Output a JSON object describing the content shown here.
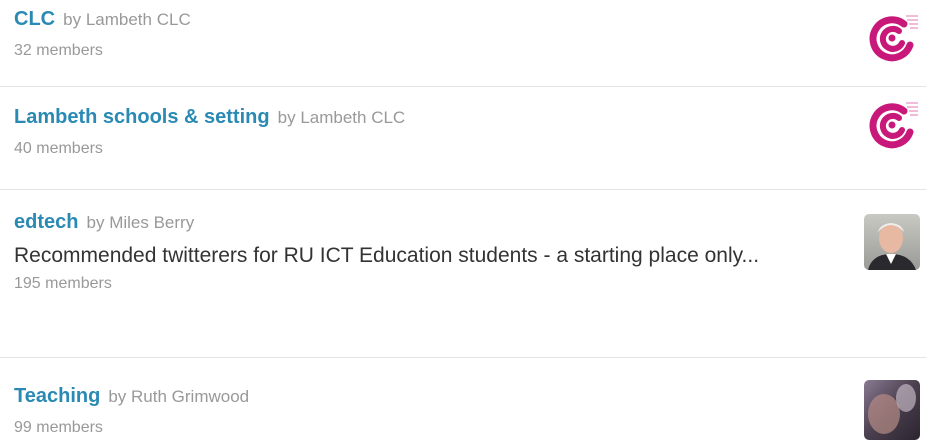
{
  "lists": [
    {
      "name": "CLC",
      "by_prefix": "by",
      "owner": "Lambeth CLC",
      "description": "",
      "members": "32 members",
      "avatar": "lambeth-clc-logo"
    },
    {
      "name": "Lambeth schools & setting",
      "by_prefix": "by",
      "owner": "Lambeth CLC",
      "description": "",
      "members": "40 members",
      "avatar": "lambeth-clc-logo"
    },
    {
      "name": "edtech",
      "by_prefix": "by",
      "owner": "Miles Berry",
      "description": "Recommended twitterers for RU ICT Education students - a starting place only...",
      "members": "195 members",
      "avatar": "profile-photo"
    },
    {
      "name": "Teaching",
      "by_prefix": "by",
      "owner": "Ruth Grimwood",
      "description": "",
      "members": "99 members",
      "avatar": "profile-photo"
    }
  ],
  "colors": {
    "link": "#2a8ab4",
    "muted": "#999999",
    "text": "#333333",
    "logo": "#c8197a"
  }
}
